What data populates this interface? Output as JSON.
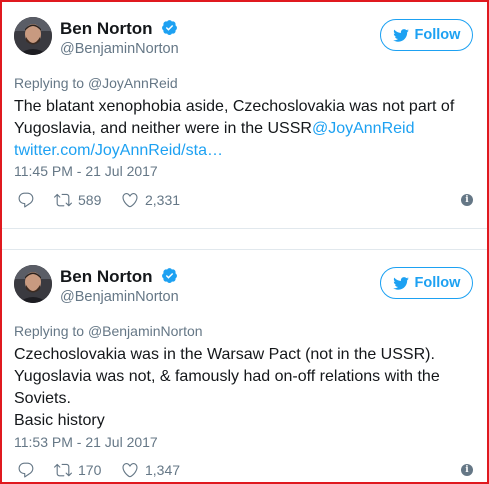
{
  "tweets": [
    {
      "display_name": "Ben Norton",
      "handle": "@BenjaminNorton",
      "follow_label": "Follow",
      "replying_prefix": "Replying to ",
      "replying_to": "@JoyAnnReid",
      "text_lines": [
        "The blatant xenophobia aside, Czechoslovakia was not part of",
        "Yugoslavia, and neither were in the USSR"
      ],
      "mention": "@JoyAnnReid",
      "link": "twitter.com/JoyAnnReid/sta…",
      "timestamp": "11:45 PM - 21 Jul 2017",
      "retweets": "589",
      "likes": "2,331"
    },
    {
      "display_name": "Ben Norton",
      "handle": "@BenjaminNorton",
      "follow_label": "Follow",
      "replying_prefix": "Replying to ",
      "replying_to": "@BenjaminNorton",
      "text_lines": [
        "Czechoslovakia was in the Warsaw Pact (not in the USSR).",
        "Yugoslavia was not, & famously had on-off relations with the",
        "Soviets.",
        "Basic history"
      ],
      "timestamp": "11:53 PM - 21 Jul 2017",
      "retweets": "170",
      "likes": "1,347"
    }
  ],
  "icons": {
    "verified": "verified-badge-icon",
    "follow": "twitter-bird-icon",
    "reply": "reply-icon",
    "retweet": "retweet-icon",
    "like": "heart-icon",
    "info": "info-icon"
  },
  "colors": {
    "accent": "#1da1f2",
    "muted": "#657786",
    "text": "#14171a",
    "frame": "#e0191f"
  }
}
